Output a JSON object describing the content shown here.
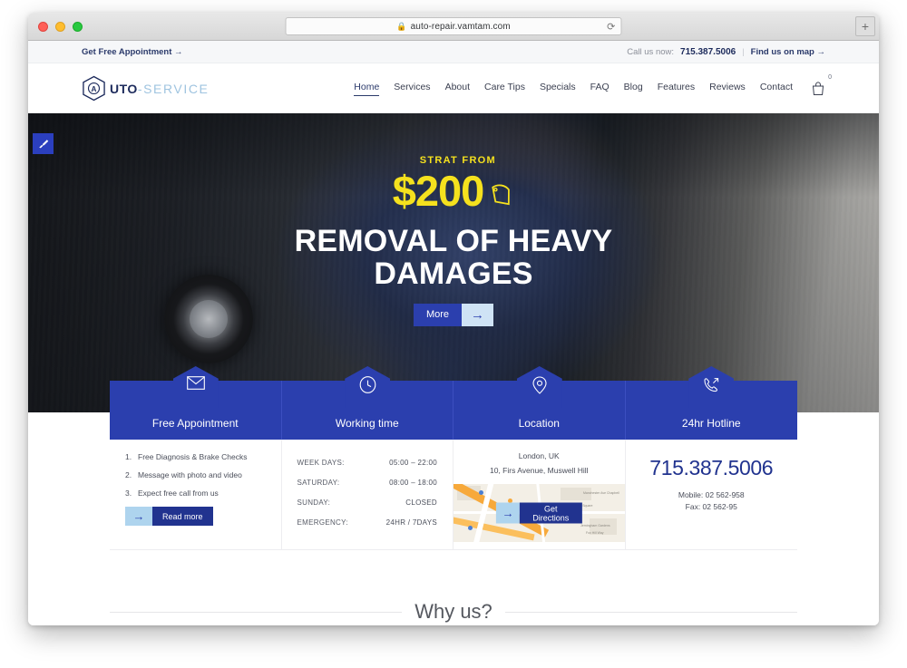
{
  "browser": {
    "url": "auto-repair.vamtam.com",
    "lock_icon": "lock-icon",
    "reload_icon": "reload-icon",
    "new_tab_label": "+",
    "traffic_lights": [
      "close",
      "minimize",
      "maximize"
    ]
  },
  "topbar": {
    "appointment_link": "Get Free Appointment →",
    "call_label": "Call us now:",
    "phone": "715.387.5006",
    "separator": "|",
    "map_link": "Find us on map →"
  },
  "header": {
    "logo": {
      "mark": "A",
      "bold": "UTO",
      "light": "-SERVICE"
    },
    "nav": [
      {
        "label": "Home",
        "active": true
      },
      {
        "label": "Services",
        "active": false
      },
      {
        "label": "About",
        "active": false
      },
      {
        "label": "Care Tips",
        "active": false
      },
      {
        "label": "Specials",
        "active": false
      },
      {
        "label": "FAQ",
        "active": false
      },
      {
        "label": "Blog",
        "active": false
      },
      {
        "label": "Features",
        "active": false
      },
      {
        "label": "Reviews",
        "active": false
      },
      {
        "label": "Contact",
        "active": false
      }
    ],
    "cart": {
      "icon": "shopping-bag-icon",
      "count": "0"
    }
  },
  "hero": {
    "customizer_icon": "paintbrush-icon",
    "eyebrow": "STRAT FROM",
    "price": "$200",
    "tag_icon": "price-tag-icon",
    "title": "REMOVAL OF HEAVY DAMAGES",
    "cta": {
      "label": "More",
      "arrow": "→"
    }
  },
  "info": {
    "appointment": {
      "icon": "envelope-icon",
      "title": "Free Appointment",
      "items": [
        "Free Diagnosis & Brake Checks",
        "Message with photo and video",
        "Expect free call from us"
      ],
      "cta": {
        "arrow": "→",
        "label": "Read more"
      }
    },
    "working_time": {
      "icon": "clock-icon",
      "title": "Working time",
      "rows": [
        {
          "label": "WEEK DAYS:",
          "value": "05:00 – 22:00"
        },
        {
          "label": "SATURDAY:",
          "value": "08:00 – 18:00"
        },
        {
          "label": "SUNDAY:",
          "value": "CLOSED"
        },
        {
          "label": "EMERGENCY:",
          "value": "24HR / 7DAYS"
        }
      ]
    },
    "location": {
      "icon": "map-pin-icon",
      "title": "Location",
      "city": "London, UK",
      "address": "10, Firs Avenue, Muswell Hill",
      "cta": {
        "arrow": "→",
        "label": "Get Directions"
      },
      "map_labels": [
        "Manchester Ave Chapbell",
        "Rochfort Square",
        "Jerningham Gardens",
        "Fox Hill Way"
      ]
    },
    "hotline": {
      "icon": "phone-outgoing-icon",
      "title": "24hr Hotline",
      "phone": "715.387.5006",
      "mobile": "Mobile: 02 562-958",
      "fax": "Fax: 02 562-95"
    }
  },
  "section": {
    "why_us_title": "Why us?"
  },
  "colors": {
    "brand_blue": "#2b3fae",
    "deep_blue": "#21338f",
    "navy_text": "#1d2b5c",
    "light_blue": "#aed4ee",
    "accent_yellow": "#f5e11e",
    "topbar_bg": "#f6f7f9"
  }
}
